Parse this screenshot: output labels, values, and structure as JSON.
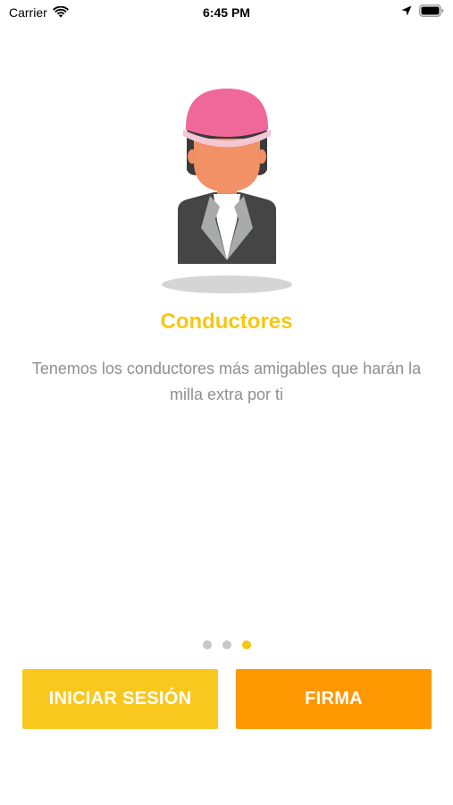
{
  "status_bar": {
    "carrier": "Carrier",
    "time": "6:45 PM",
    "icons": [
      "wifi-icon",
      "location-arrow-icon",
      "battery-icon"
    ]
  },
  "onboarding": {
    "illustration": "driver-avatar-illustration",
    "title": "Conductores",
    "description": "Tenemos los conductores más amigables que harán la milla extra por ti",
    "pages": {
      "count": 3,
      "current": 3
    }
  },
  "buttons": {
    "login_label": "INICIAR SESIÓN",
    "signup_label": "FIRMA"
  },
  "colors": {
    "title": "#f6c713",
    "description": "#8f8f8f",
    "login_button": "#f8c81f",
    "signup_button": "#ff9800",
    "dot_inactive": "#c7c7c7",
    "dot_active": "#f6c713"
  }
}
